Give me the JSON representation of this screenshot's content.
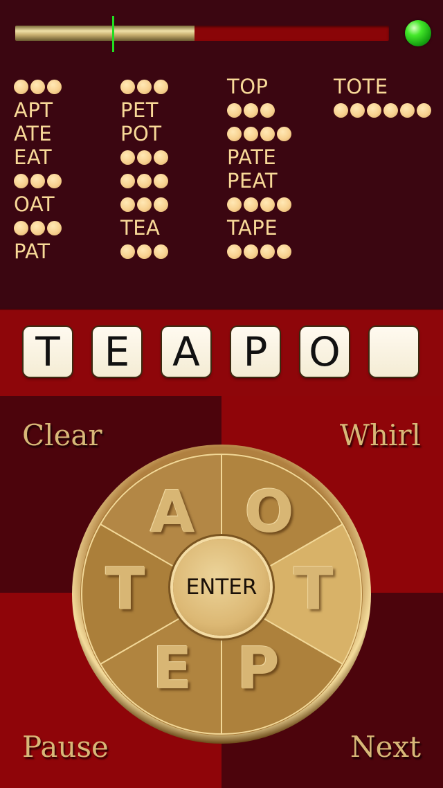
{
  "progress": {
    "fill_fraction": 0.48,
    "marker_fraction": 0.26
  },
  "word_columns": [
    {
      "entries": [
        {
          "hidden_len": 3
        },
        {
          "word": "APT"
        },
        {
          "word": "ATE"
        },
        {
          "word": "EAT"
        },
        {
          "hidden_len": 3
        },
        {
          "word": "OAT"
        },
        {
          "hidden_len": 3
        },
        {
          "word": "PAT"
        }
      ]
    },
    {
      "entries": [
        {
          "hidden_len": 3
        },
        {
          "word": "PET"
        },
        {
          "word": "POT"
        },
        {
          "hidden_len": 3
        },
        {
          "hidden_len": 3
        },
        {
          "hidden_len": 3
        },
        {
          "word": "TEA"
        },
        {
          "hidden_len": 3
        }
      ]
    },
    {
      "entries": [
        {
          "word": "TOP"
        },
        {
          "hidden_len": 3
        },
        {
          "hidden_len": 4
        },
        {
          "word": "PATE"
        },
        {
          "word": "PEAT"
        },
        {
          "hidden_len": 4
        },
        {
          "word": "TAPE"
        },
        {
          "hidden_len": 4
        }
      ]
    },
    {
      "entries": [
        {
          "word": "TOTE"
        },
        {
          "hidden_len": 6
        }
      ]
    }
  ],
  "tray_tiles": [
    "T",
    "E",
    "A",
    "P",
    "O",
    ""
  ],
  "controls": {
    "clear": "Clear",
    "whirl": "Whirl",
    "pause": "Pause",
    "next": "Next",
    "enter": "ENTER"
  },
  "wheel_letters": {
    "top_left": "A",
    "top_right": "O",
    "right": "T",
    "bottom_right": "P",
    "bottom_left": "E",
    "left": "T"
  },
  "colors": {
    "status_light": "#33dd22",
    "highlight_segment": "#d8b268"
  },
  "icons": {
    "status": "green-status-light-icon"
  }
}
